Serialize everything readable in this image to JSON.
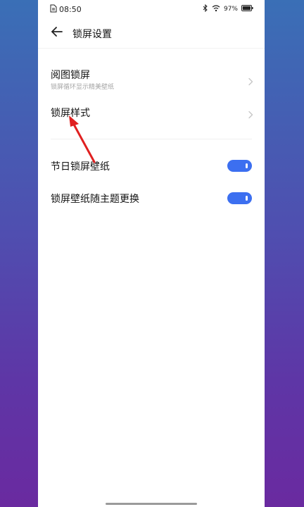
{
  "status_bar": {
    "time": "08:50",
    "battery_text": "97%"
  },
  "header": {
    "title": "锁屏设置"
  },
  "rows": [
    {
      "title": "阅图锁屏",
      "subtitle": "锁屏循环显示精美壁纸"
    },
    {
      "title": "锁屏样式"
    }
  ],
  "toggles": [
    {
      "title": "节日锁屏壁纸",
      "enabled": true
    },
    {
      "title": "锁屏壁纸随主题更换",
      "enabled": true
    }
  ],
  "colors": {
    "accent": "#3c6ff0",
    "annotation_arrow": "#e02020"
  },
  "icons": {
    "status_doc": "document-icon",
    "bluetooth": "bluetooth-icon",
    "wifi": "wifi-icon",
    "battery": "battery-icon",
    "back": "back-arrow-icon",
    "chevron": "chevron-right-icon"
  }
}
